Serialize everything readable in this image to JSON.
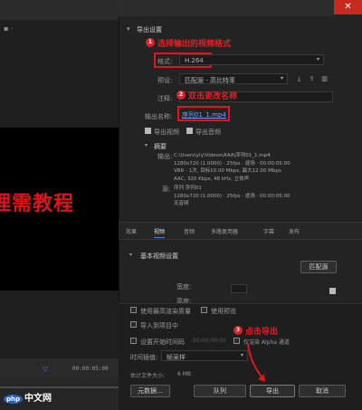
{
  "window": {
    "close_glyph": "✕"
  },
  "left": {
    "menu_dots": "▪ ·",
    "preview_text": "理需教程",
    "timeline_left": "",
    "timeline_marker": "▽",
    "timecode": "00:00:05:00"
  },
  "export_settings": {
    "section_title": "导出设置",
    "format_label": "格式:",
    "format_value": "H.264",
    "preset_label": "预设:",
    "preset_value": "匹配源 - 高比特率",
    "comment_label": "注释:",
    "output_name_label": "输出名称:",
    "output_name_value": "序列01_1.mp4",
    "export_video_label": "导出视频",
    "export_audio_label": "导出音频"
  },
  "summary": {
    "title": "摘要",
    "output_label": "输出:",
    "output_lines": [
      "C:\\Users\\yly\\Videos\\AAA\\序列01_1.mp4",
      "1280x720 (1.0000) · 25fps · 逐场 · 00:00:05:00",
      "VBR · 1次, 目标10.00 Mbps, 最大12.00 Mbps",
      "AAC, 320 Kbps, 48 kHz, 立体声"
    ],
    "source_label": "源:",
    "source_lines": [
      "序列 序列01",
      "1280x720 (1.0000) · 25fps · 逐场 · 00:00:05:00",
      "无音频"
    ]
  },
  "tabs": [
    "效果",
    "视频",
    "音频",
    "多路复用器",
    "字幕",
    "发布"
  ],
  "video_settings": {
    "section_title": "基本视频设置",
    "match_source_button": "匹配源",
    "width_label": "宽度:",
    "height_label": "高度:"
  },
  "options": {
    "max_render_quality": "使用最高渲染质量",
    "use_previews": "使用预览",
    "import_into_project": "导入到项目中",
    "set_start_timecode": "设置开始时间码",
    "start_timecode_value": "00:00:00:00",
    "render_alpha_only": "仅渲染 Alpha 通道",
    "time_interpolation_label": "时间插值:",
    "time_interpolation_value": "帧采样",
    "estimated_size_label": "估计文件大小:",
    "estimated_size_value": "6 MB"
  },
  "buttons": {
    "metadata": "元数据...",
    "queue": "队列",
    "export": "导出",
    "cancel": "取消"
  },
  "annotations": {
    "a1_num": "1",
    "a1_text": "选择输出的视频格式",
    "a2_num": "2",
    "a2_text": "双击更改名称",
    "a3_num": "3",
    "a3_text": "点击导出"
  },
  "watermark": {
    "logo": "php",
    "text": "中文网"
  },
  "colors": {
    "annotation_red": "#e0161c",
    "close_red": "#c42b1c"
  }
}
